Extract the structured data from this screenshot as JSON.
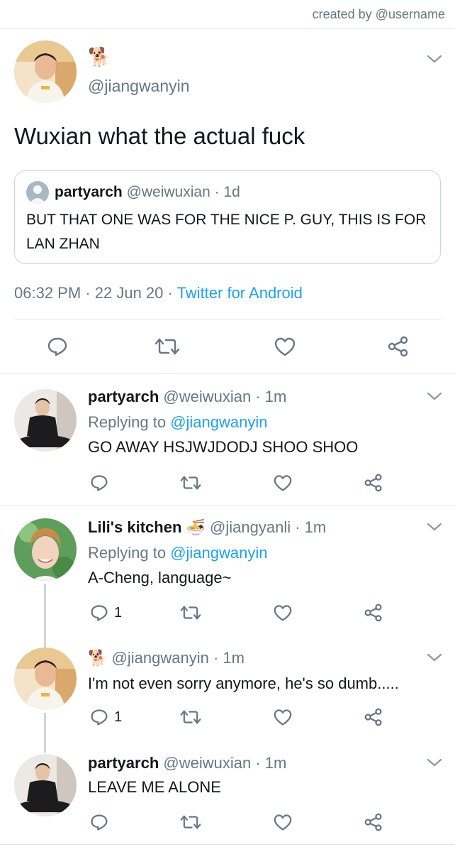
{
  "credit": "created by @username",
  "main": {
    "emoji": "🐕",
    "handle": "@jiangwanyin",
    "text": "Wuxian what the actual fuck",
    "quote": {
      "name": "partyarch",
      "handle": "@weiwuxian",
      "time": "· 1d",
      "text": "BUT THAT ONE WAS FOR THE NICE P. GUY, THIS IS FOR LAN ZHAN"
    },
    "time": "06:32 PM",
    "dot1": "·",
    "date": "22 Jun 20",
    "dot2": "·",
    "client": "Twitter for Android"
  },
  "replies": [
    {
      "name": "partyarch",
      "handle": "@weiwuxian",
      "time": "· 1m",
      "replying_prefix": "Replying to",
      "replying_to": "@jiangwanyin",
      "text": "GO AWAY HSJWJDODJ SHOO SHOO",
      "reply_count": ""
    },
    {
      "name": "Lili's kitchen",
      "emoji": "🍜",
      "handle": "@jiangyanli",
      "time": "· 1m",
      "replying_prefix": "Replying to",
      "replying_to": "@jiangwanyin",
      "text": "A-Cheng, language~",
      "reply_count": "1"
    },
    {
      "emoji": "🐕",
      "handle": "@jiangwanyin",
      "time": "· 1m",
      "text": "I'm not even sorry anymore, he's so dumb.....",
      "reply_count": "1"
    },
    {
      "name": "partyarch",
      "handle": "@weiwuxian",
      "time": "· 1m",
      "text": "LEAVE ME ALONE",
      "reply_count": ""
    }
  ],
  "colors": {
    "accent": "#1da1f2",
    "muted": "#657786",
    "separator": "#e1e8ed",
    "text": "#14171a"
  }
}
